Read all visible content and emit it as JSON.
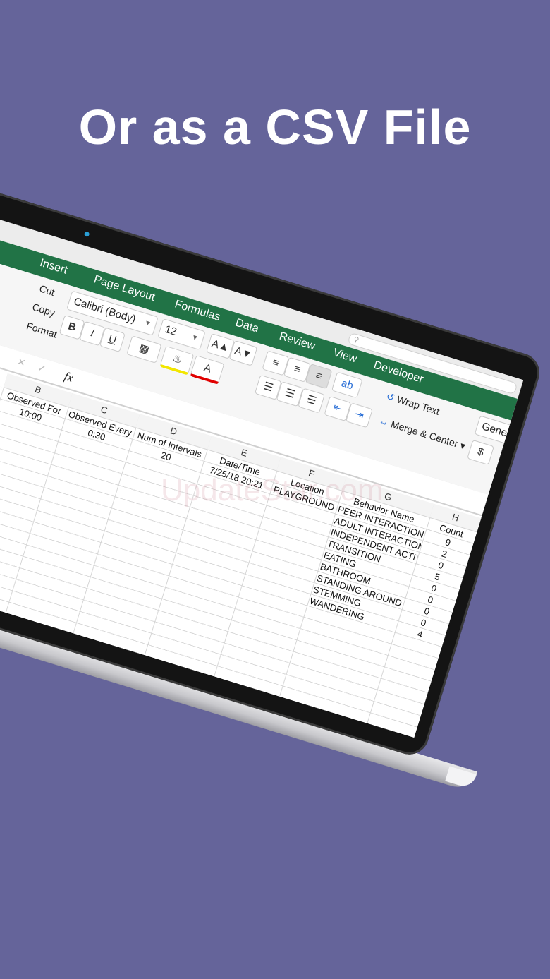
{
  "headline": "Or as a CSV File",
  "watermark": "UpdateStar.com",
  "ribbon": {
    "tabs": [
      "Insert",
      "Page Layout",
      "Formulas",
      "Data",
      "Review",
      "View",
      "Developer"
    ],
    "clipboard": [
      "Cut",
      "Copy",
      "Format"
    ],
    "font_name": "Calibri (Body)",
    "font_size": "12",
    "bold": "B",
    "italic": "I",
    "underline": "U",
    "grow_font": "A▲",
    "shrink_font": "A▼",
    "font_color": "A",
    "orientation": "ab",
    "wrap_text": "Wrap Text",
    "merge_center": "Merge & Center",
    "number_format": "General",
    "currency": "$",
    "formula_fx": "fx"
  },
  "sheet": {
    "columns": [
      {
        "letter": "B",
        "header": "Observed For",
        "value": "10:00"
      },
      {
        "letter": "C",
        "header": "Observed Every",
        "value": "0:30"
      },
      {
        "letter": "D",
        "header": "Num of Intervals",
        "value": "20"
      },
      {
        "letter": "E",
        "header": "Date/Time",
        "value": "7/25/18 20:21"
      },
      {
        "letter": "F",
        "header": "Location",
        "value": "PLAYGROUND"
      },
      {
        "letter": "G",
        "header": "Behavior Name"
      },
      {
        "letter": "H",
        "header": "Count"
      }
    ],
    "behaviors": [
      {
        "name": "PEER INTERACTION",
        "count": "9"
      },
      {
        "name": "ADULT INTERACTION",
        "count": "2"
      },
      {
        "name": "INDEPENDENT ACTIVITY",
        "count": "0"
      },
      {
        "name": "TRANSITION",
        "count": "5"
      },
      {
        "name": "EATING",
        "count": "0"
      },
      {
        "name": "BATHROOM",
        "count": "0"
      },
      {
        "name": "STANDING AROUND",
        "count": "0"
      },
      {
        "name": "STEMMING",
        "count": "0"
      },
      {
        "name": "WANDERING",
        "count": "4"
      }
    ]
  },
  "colors": {
    "background": "#65649a",
    "excel_green": "#217346"
  }
}
